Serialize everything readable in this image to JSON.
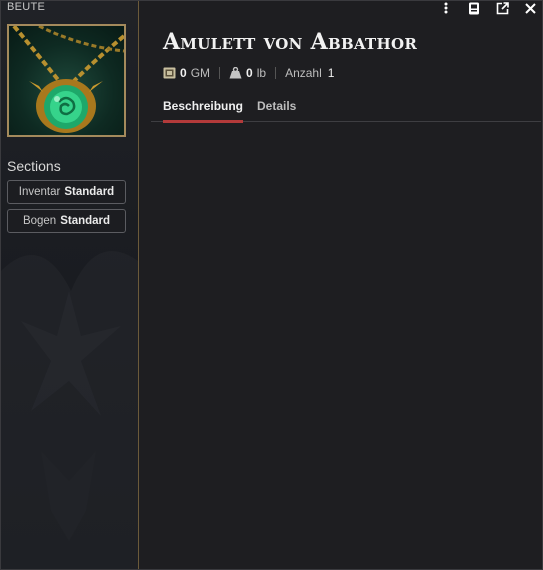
{
  "sidebar": {
    "item_type": "BEUTE",
    "portrait_icon": "green-amulet-icon",
    "sections_title": "Sections",
    "buttons": [
      {
        "prefix": "Inventar",
        "value": "Standard"
      },
      {
        "prefix": "Bogen",
        "value": "Standard"
      }
    ]
  },
  "header": {
    "controls": [
      "more-vertical-icon",
      "sheet-icon",
      "popout-icon",
      "close-icon"
    ]
  },
  "item": {
    "name": "Amulett von Abbathor",
    "price_value": "0",
    "price_unit": "GM",
    "weight_value": "0",
    "weight_unit": "lb",
    "quantity_label": "Anzahl",
    "quantity_value": "1"
  },
  "tabs": [
    {
      "label": "Beschreibung",
      "active": true
    },
    {
      "label": "Details",
      "active": false
    }
  ],
  "colors": {
    "accent_tab": "#b33a3a",
    "border_gold": "#a48a5c",
    "background": "#1e1e21"
  }
}
